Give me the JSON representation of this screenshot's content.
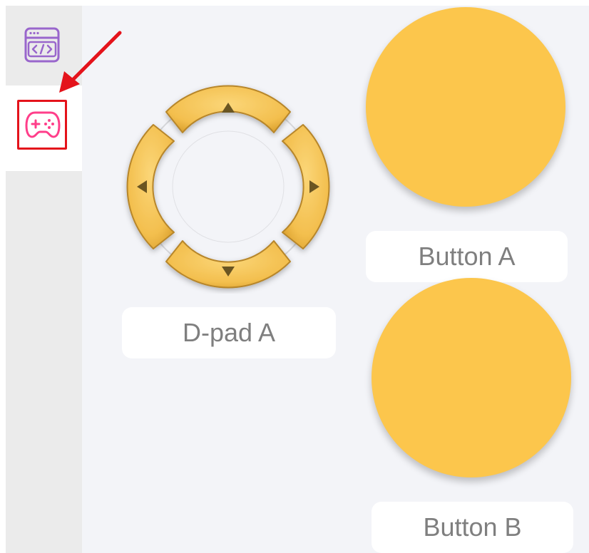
{
  "sidebar": {
    "items": [
      {
        "icon": "code-window-icon",
        "color": "#9966cc"
      },
      {
        "icon": "gamepad-icon",
        "color": "#ff3e8a",
        "selected": true
      }
    ],
    "highlight_color": "#e4131b"
  },
  "widgets": {
    "dpad": {
      "label": "D-pad A"
    },
    "button_a": {
      "label": "Button A"
    },
    "button_b": {
      "label": "Button B"
    }
  },
  "colors": {
    "canvas_bg": "#f3f4f8",
    "sidebar_bg": "#ebebeb",
    "widget_yellow": "#fcc64c",
    "dpad_gold": "#f5c456",
    "arrow_glyph": "#6b5423",
    "label_text": "#7f7f7f",
    "annotation_arrow": "#e4131b"
  }
}
